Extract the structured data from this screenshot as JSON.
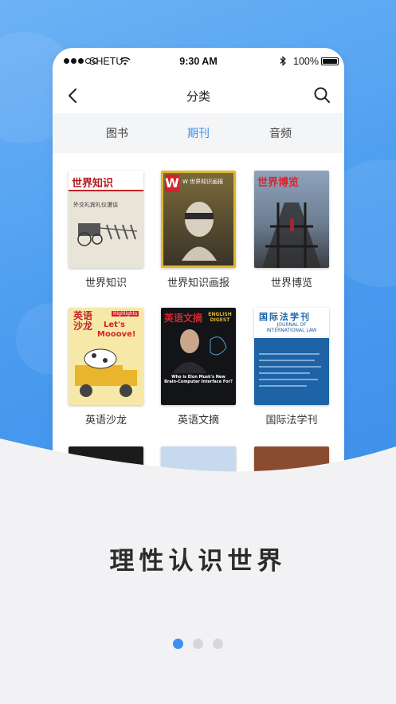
{
  "status_bar": {
    "carrier": "SHETU",
    "time": "9:30 AM",
    "battery": "100%"
  },
  "nav": {
    "title": "分类",
    "back_icon": "chevron-left-icon",
    "search_icon": "search-icon"
  },
  "tabs": [
    {
      "label": "图书",
      "active": false
    },
    {
      "label": "期刊",
      "active": true
    },
    {
      "label": "音频",
      "active": false
    }
  ],
  "magazines": [
    {
      "label": "世界知识"
    },
    {
      "label": "世界知识画报"
    },
    {
      "label": "世界博览"
    },
    {
      "label": "英语沙龙"
    },
    {
      "label": "英语文摘"
    },
    {
      "label": "国际法学刊"
    }
  ],
  "covers": {
    "shijie_zhishi": {
      "masthead": "世界知识",
      "line": "外交礼宾礼仪漫谈"
    },
    "huabao": {
      "masthead": "W 世界知识画报"
    },
    "bolan": {
      "masthead": "世界博览"
    },
    "shalong": {
      "masthead": "英语沙龙",
      "tag": "Highlights",
      "line1": "Let's",
      "line2": "Mooove!"
    },
    "wenzhai": {
      "masthead": "英语文摘",
      "sub": "ENGLISH DIGEST",
      "headline": "Who is Elon Musk's New Brain-Computer Interface For?"
    },
    "faxue": {
      "masthead": "国际法学刊",
      "sub1": "JOURNAL OF",
      "sub2": "INTERNATIONAL LAW"
    }
  },
  "slogan": "理性认识世界",
  "pagination": {
    "count": 3,
    "active_index": 0
  },
  "colors": {
    "accent": "#3d8ff0",
    "background_blue": "#4a9cf0"
  }
}
